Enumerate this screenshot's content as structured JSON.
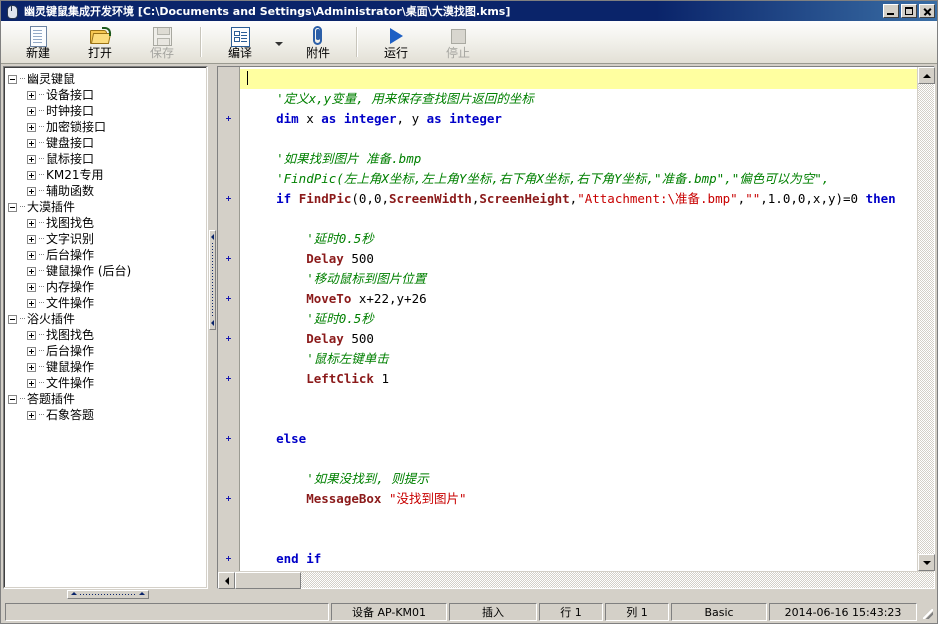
{
  "window": {
    "title": "幽灵键鼠集成开发环境  [C:\\Documents and Settings\\Administrator\\桌面\\大漠找图.kms]",
    "icon": "mouse-icon",
    "buttons": {
      "minimize": "_",
      "maximize": "□",
      "close": "✕"
    }
  },
  "toolbar": {
    "items": [
      {
        "label": "新建",
        "icon": "new-file-icon",
        "enabled": true
      },
      {
        "label": "打开",
        "icon": "open-folder-icon",
        "enabled": true
      },
      {
        "label": "保存",
        "icon": "save-disk-icon",
        "enabled": false
      },
      {
        "label": "编译",
        "icon": "compile-icon",
        "enabled": true
      },
      {
        "label": "附件",
        "icon": "paperclip-icon",
        "enabled": true
      },
      {
        "label": "运行",
        "icon": "run-triangle-icon",
        "enabled": true
      },
      {
        "label": "停止",
        "icon": "stop-square-icon",
        "enabled": false
      }
    ]
  },
  "tree": {
    "groups": [
      {
        "label": "幽灵键鼠",
        "expanded": true,
        "children": [
          "设备接口",
          "时钟接口",
          "加密锁接口",
          "键盘接口",
          "鼠标接口",
          "KM21专用",
          "辅助函数"
        ]
      },
      {
        "label": "大漠插件",
        "expanded": true,
        "children": [
          "找图找色",
          "文字识别",
          "后台操作",
          "键鼠操作 (后台)",
          "内存操作",
          "文件操作"
        ]
      },
      {
        "label": "浴火插件",
        "expanded": true,
        "children": [
          "找图找色",
          "后台操作",
          "键鼠操作",
          "文件操作"
        ]
      },
      {
        "label": "答题插件",
        "expanded": true,
        "children": [
          "石象答题"
        ]
      }
    ]
  },
  "editor": {
    "lines": [
      {
        "marker": false,
        "highlight": true,
        "caret": true,
        "tokens": []
      },
      {
        "marker": false,
        "tokens": [
          {
            "t": "cm",
            "v": "    '定义x,y变量, 用来保存查找图片返回的坐标"
          }
        ]
      },
      {
        "marker": true,
        "tokens": [
          {
            "t": "kw",
            "v": "    dim"
          },
          {
            "t": "pl",
            "v": " x "
          },
          {
            "t": "kw",
            "v": "as integer"
          },
          {
            "t": "pl",
            "v": ", y "
          },
          {
            "t": "kw",
            "v": "as integer"
          }
        ]
      },
      {
        "marker": false,
        "tokens": []
      },
      {
        "marker": false,
        "tokens": [
          {
            "t": "cm",
            "v": "    '如果找到图片 准备.bmp"
          }
        ]
      },
      {
        "marker": false,
        "tokens": [
          {
            "t": "cm",
            "v": "    'FindPic(左上角X坐标,左上角Y坐标,右下角X坐标,右下角Y坐标,\"准备.bmp\",\"偏色可以为空\","
          }
        ]
      },
      {
        "marker": true,
        "tokens": [
          {
            "t": "kw",
            "v": "    if "
          },
          {
            "t": "fn",
            "v": "FindPic"
          },
          {
            "t": "pl",
            "v": "(0,0,"
          },
          {
            "t": "fn",
            "v": "ScreenWidth"
          },
          {
            "t": "pl",
            "v": ","
          },
          {
            "t": "fn",
            "v": "ScreenHeight"
          },
          {
            "t": "pl",
            "v": ","
          },
          {
            "t": "str",
            "v": "\"Attachment:\\准备.bmp\""
          },
          {
            "t": "pl",
            "v": ","
          },
          {
            "t": "str",
            "v": "\"\""
          },
          {
            "t": "pl",
            "v": ",1.0,0,x,y)=0 "
          },
          {
            "t": "kw",
            "v": "then"
          }
        ]
      },
      {
        "marker": false,
        "tokens": []
      },
      {
        "marker": false,
        "tokens": [
          {
            "t": "cm",
            "v": "        '延时0.5秒"
          }
        ]
      },
      {
        "marker": true,
        "tokens": [
          {
            "t": "fn",
            "v": "        Delay"
          },
          {
            "t": "pl",
            "v": " 500"
          }
        ]
      },
      {
        "marker": false,
        "tokens": [
          {
            "t": "cm",
            "v": "        '移动鼠标到图片位置"
          }
        ]
      },
      {
        "marker": true,
        "tokens": [
          {
            "t": "fn",
            "v": "        MoveTo"
          },
          {
            "t": "pl",
            "v": " x+22,y+26"
          }
        ]
      },
      {
        "marker": false,
        "tokens": [
          {
            "t": "cm",
            "v": "        '延时0.5秒"
          }
        ]
      },
      {
        "marker": true,
        "tokens": [
          {
            "t": "fn",
            "v": "        Delay"
          },
          {
            "t": "pl",
            "v": " 500"
          }
        ]
      },
      {
        "marker": false,
        "tokens": [
          {
            "t": "cm",
            "v": "        '鼠标左键单击"
          }
        ]
      },
      {
        "marker": true,
        "tokens": [
          {
            "t": "fn",
            "v": "        LeftClick"
          },
          {
            "t": "pl",
            "v": " 1"
          }
        ]
      },
      {
        "marker": false,
        "tokens": []
      },
      {
        "marker": false,
        "tokens": []
      },
      {
        "marker": true,
        "tokens": [
          {
            "t": "kw",
            "v": "    else"
          }
        ]
      },
      {
        "marker": false,
        "tokens": []
      },
      {
        "marker": false,
        "tokens": [
          {
            "t": "cm",
            "v": "        '如果没找到, 则提示"
          }
        ]
      },
      {
        "marker": true,
        "tokens": [
          {
            "t": "fn",
            "v": "        MessageBox"
          },
          {
            "t": "pl",
            "v": " "
          },
          {
            "t": "str",
            "v": "\"没找到图片\""
          }
        ]
      },
      {
        "marker": false,
        "tokens": []
      },
      {
        "marker": false,
        "tokens": []
      },
      {
        "marker": true,
        "tokens": [
          {
            "t": "kw",
            "v": "    end if"
          }
        ]
      }
    ]
  },
  "statusbar": {
    "device": "设备 AP-KM01",
    "insert_mode": "插入",
    "row": "行 1",
    "col": "列 1",
    "language": "Basic",
    "datetime": "2014-06-16 15:43:23"
  }
}
